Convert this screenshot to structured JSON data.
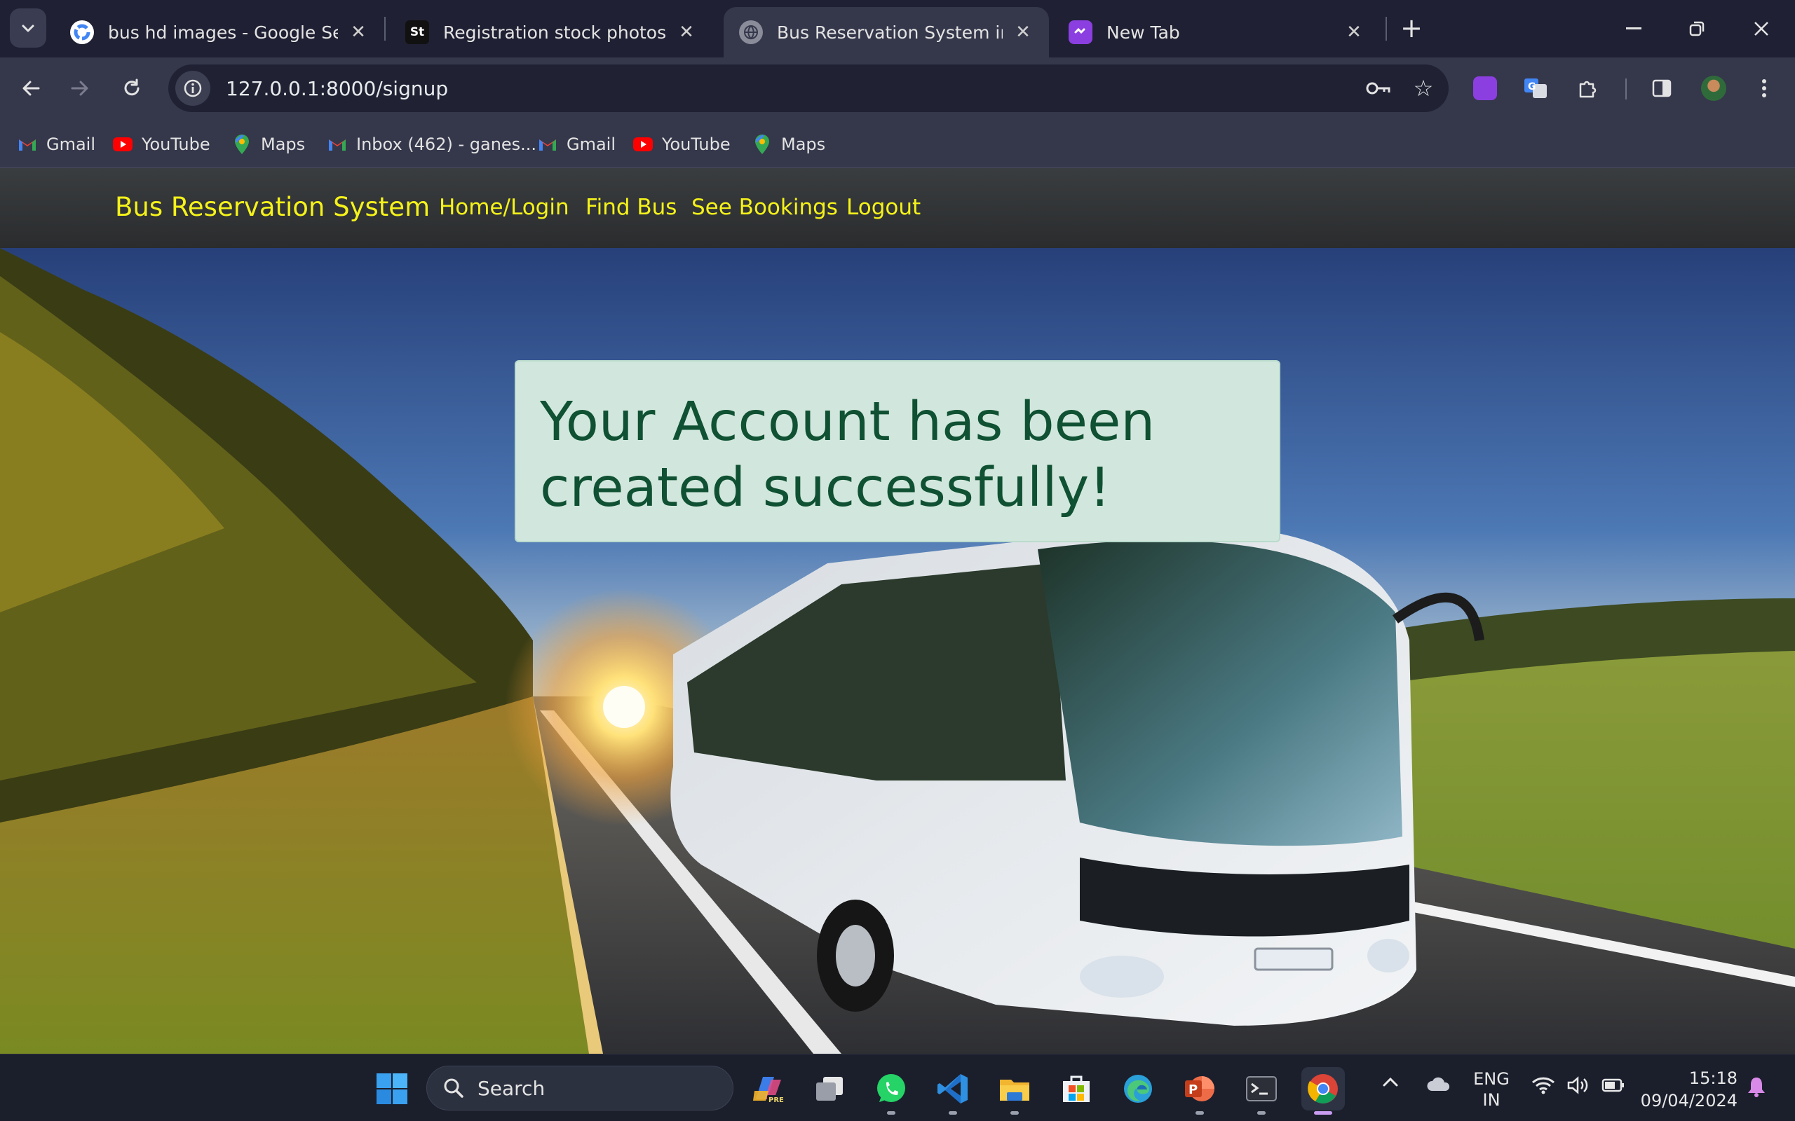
{
  "browser": {
    "tabs": [
      {
        "title": "bus hd images - Google Search",
        "favicon": "google-icon",
        "active": false
      },
      {
        "title": "Registration stock photos, royal",
        "favicon": "shutterstock-icon",
        "active": false
      },
      {
        "title": "Bus Reservation System in Djan",
        "favicon": "globe-icon",
        "active": true
      },
      {
        "title": "New Tab",
        "favicon": "tab-icon",
        "active": false
      }
    ],
    "url": "127.0.0.1:8000/signup",
    "bookmarks": [
      {
        "label": "Gmail",
        "icon": "gmail-icon"
      },
      {
        "label": "YouTube",
        "icon": "youtube-icon"
      },
      {
        "label": "Maps",
        "icon": "maps-icon"
      },
      {
        "label": "Inbox (462) - ganes...",
        "icon": "gmail-icon"
      },
      {
        "label": "Gmail",
        "icon": "gmail-icon"
      },
      {
        "label": "YouTube",
        "icon": "youtube-icon"
      },
      {
        "label": "Maps",
        "icon": "maps-icon"
      }
    ]
  },
  "site": {
    "brand": "Bus Reservation System",
    "nav": [
      "Home/Login",
      "Find Bus",
      "See Bookings",
      "Logout"
    ],
    "alert_line1": "Your Account has been",
    "alert_line2": "created successfully!",
    "colors": {
      "nav_text": "#f5f21a",
      "alert_bg": "#d1e7dd",
      "alert_text": "#0f5132"
    }
  },
  "taskbar": {
    "search_label": "Search",
    "language_line1": "ENG",
    "language_line2": "IN",
    "time": "15:18",
    "date": "09/04/2024"
  }
}
